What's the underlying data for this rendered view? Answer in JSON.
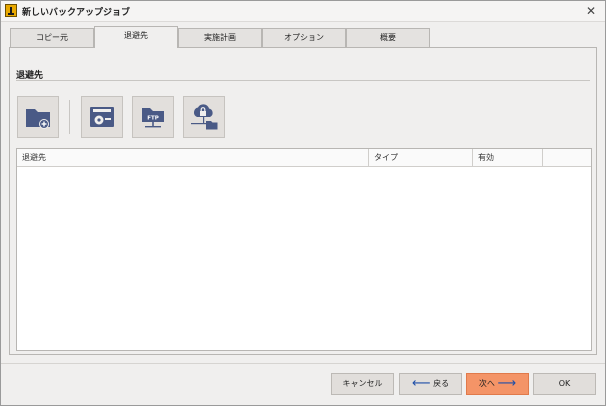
{
  "window": {
    "title": "新しいバックアップジョブ",
    "close_glyph": "✕"
  },
  "tabs": [
    {
      "label": "コピー元",
      "active": false
    },
    {
      "label": "退避先",
      "active": true
    },
    {
      "label": "実施計画",
      "active": false
    },
    {
      "label": "オプション",
      "active": false
    },
    {
      "label": "概要",
      "active": false
    }
  ],
  "section": {
    "title": "退避先"
  },
  "tools": [
    {
      "icon": "add-folder-icon"
    },
    {
      "icon": "disk-drive-icon"
    },
    {
      "icon": "ftp-folder-icon"
    },
    {
      "icon": "cloud-network-icon"
    }
  ],
  "ftp_label": "FTP",
  "list": {
    "columns": [
      "退避先",
      "タイプ",
      "有効",
      ""
    ],
    "rows": []
  },
  "footer": {
    "cancel": "キャンセル",
    "back": "戻る",
    "next": "次へ",
    "ok": "OK"
  },
  "colors": {
    "primary": "#f49467",
    "icon": "#4a5a86",
    "arrow": "#1f4fa8"
  }
}
